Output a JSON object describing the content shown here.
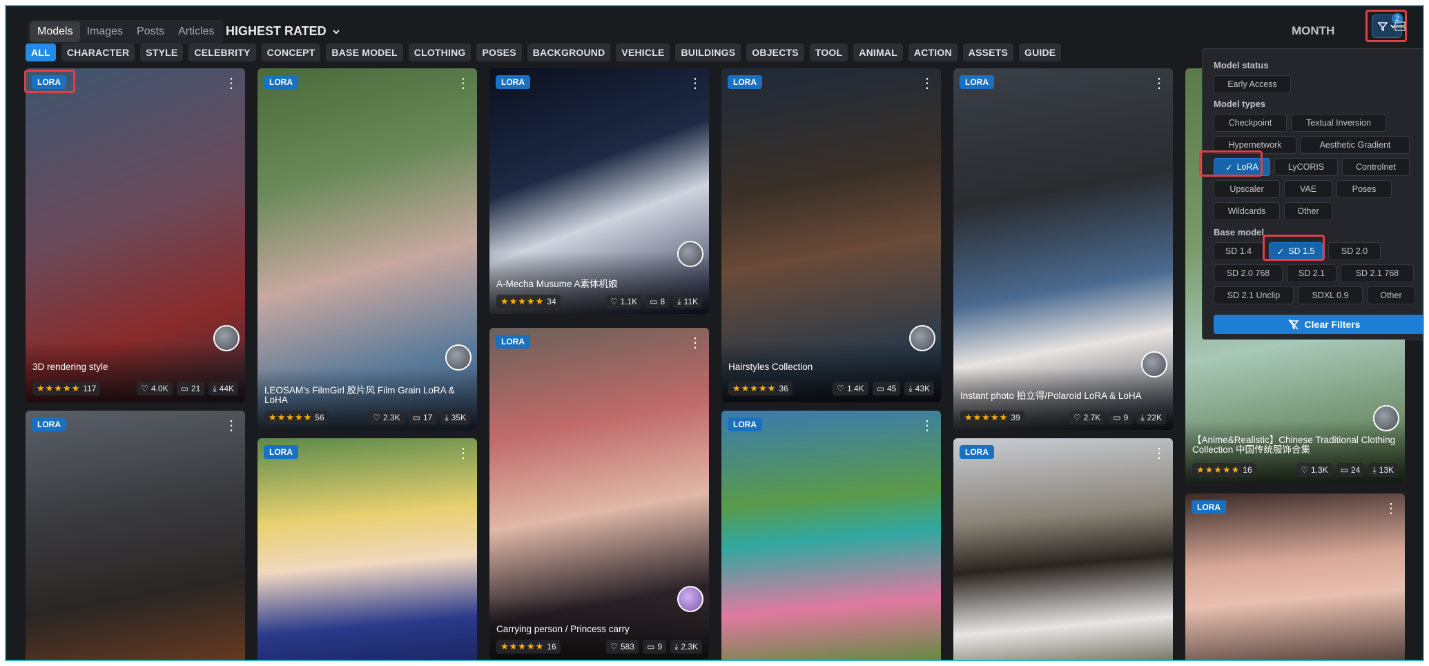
{
  "header": {
    "tabs": [
      "Models",
      "Images",
      "Posts",
      "Articles"
    ],
    "sort_label": "HIGHEST RATED",
    "period_label": "MONTH",
    "filter_count": "2"
  },
  "categories": [
    "ALL",
    "CHARACTER",
    "STYLE",
    "CELEBRITY",
    "CONCEPT",
    "BASE MODEL",
    "CLOTHING",
    "POSES",
    "BACKGROUND",
    "VEHICLE",
    "BUILDINGS",
    "OBJECTS",
    "TOOL",
    "ANIMAL",
    "ACTION",
    "ASSETS",
    "GUIDE"
  ],
  "badge_label": "LORA",
  "cards": [
    {
      "title": "3D rendering style",
      "rating": "117",
      "likes": "4.0K",
      "comments": "21",
      "downloads": "44K"
    },
    {
      "title": "LEOSAM's FilmGirl 胶片风 Film Grain LoRA & LoHA",
      "rating": "56",
      "likes": "2.3K",
      "comments": "17",
      "downloads": "35K"
    },
    {
      "title": "A-Mecha Musume A素体机娘",
      "rating": "34",
      "likes": "1.1K",
      "comments": "8",
      "downloads": "11K"
    },
    {
      "title": "Hairstyles Collection",
      "rating": "36",
      "likes": "1.4K",
      "comments": "45",
      "downloads": "43K"
    },
    {
      "title": "Instant photo 拍立得/Polaroid LoRA & LoHA",
      "rating": "39",
      "likes": "2.7K",
      "comments": "9",
      "downloads": "22K"
    },
    {
      "title": "【Anime&Realistic】Chinese Traditional Clothing Collection 中国传统服饰合集",
      "rating": "16",
      "likes": "1.3K",
      "comments": "24",
      "downloads": "13K"
    },
    {
      "title": "Carrying person / Princess carry",
      "rating": "16",
      "likes": "583",
      "comments": "9",
      "downloads": "2.3K"
    }
  ],
  "filter": {
    "model_status_label": "Model status",
    "model_status": [
      "Early Access"
    ],
    "model_types_label": "Model types",
    "model_types": [
      "Checkpoint",
      "Textual Inversion",
      "Hypernetwork",
      "Aesthetic Gradient",
      "LoRA",
      "LyCORIS",
      "Controlnet",
      "Upscaler",
      "VAE",
      "Poses",
      "Wildcards",
      "Other"
    ],
    "base_model_label": "Base model",
    "base_models": [
      "SD 1.4",
      "SD 1.5",
      "SD 2.0",
      "SD 2.0 768",
      "SD 2.1",
      "SD 2.1 768",
      "SD 2.1 Unclip",
      "SDXL 0.9",
      "Other"
    ],
    "clear_label": "Clear Filters"
  },
  "colors": {
    "accent": "#1c7ed6",
    "highlight": "#e03f46",
    "frame": "#2bb5c9",
    "background": "#1a1b1e"
  }
}
